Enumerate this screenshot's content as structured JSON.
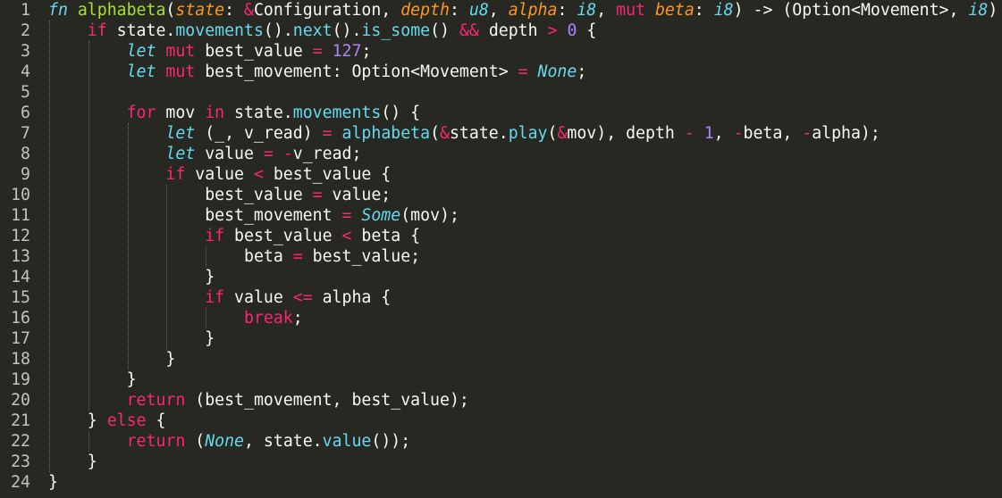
{
  "editor": {
    "language": "rust",
    "colors": {
      "background": "#272822",
      "text": "#f8f8f2",
      "keyword": "#f92672",
      "function_name": "#a6e22e",
      "parameter": "#fd971f",
      "type": "#66d9ef",
      "number": "#ae81ff",
      "line_number": "#c2c2bf"
    },
    "lines": [
      {
        "n": "1",
        "indent": 0,
        "tokens": [
          [
            "fnkw",
            "fn"
          ],
          [
            "id",
            " "
          ],
          [
            "fn",
            "alphabeta"
          ],
          [
            "id",
            "("
          ],
          [
            "param",
            "state"
          ],
          [
            "id",
            ": "
          ],
          [
            "kw",
            "&"
          ],
          [
            "id",
            "Configuration, "
          ],
          [
            "param",
            "depth"
          ],
          [
            "id",
            ": "
          ],
          [
            "type",
            "u8"
          ],
          [
            "id",
            ", "
          ],
          [
            "param",
            "alpha"
          ],
          [
            "id",
            ": "
          ],
          [
            "type",
            "i8"
          ],
          [
            "id",
            ", "
          ],
          [
            "kw",
            "mut"
          ],
          [
            "id",
            " "
          ],
          [
            "param",
            "beta"
          ],
          [
            "id",
            ": "
          ],
          [
            "type",
            "i8"
          ],
          [
            "id",
            ") -> (Option<Movement>, "
          ],
          [
            "type",
            "i8"
          ],
          [
            "id",
            ")"
          ]
        ]
      },
      {
        "n": "2",
        "indent": 1,
        "tokens": [
          [
            "kw",
            "if"
          ],
          [
            "id",
            " state."
          ],
          [
            "call",
            "movements"
          ],
          [
            "id",
            "()."
          ],
          [
            "call",
            "next"
          ],
          [
            "id",
            "()."
          ],
          [
            "call",
            "is_some"
          ],
          [
            "id",
            "() "
          ],
          [
            "kw",
            "&&"
          ],
          [
            "id",
            " depth "
          ],
          [
            "kw",
            ">"
          ],
          [
            "id",
            " "
          ],
          [
            "num",
            "0"
          ],
          [
            "id",
            " {"
          ]
        ]
      },
      {
        "n": "3",
        "indent": 2,
        "tokens": [
          [
            "fnkw",
            "let"
          ],
          [
            "id",
            " "
          ],
          [
            "kw",
            "mut"
          ],
          [
            "id",
            " best_value "
          ],
          [
            "kw",
            "="
          ],
          [
            "id",
            " "
          ],
          [
            "num",
            "127"
          ],
          [
            "id",
            ";"
          ]
        ]
      },
      {
        "n": "4",
        "indent": 2,
        "tokens": [
          [
            "fnkw",
            "let"
          ],
          [
            "id",
            " "
          ],
          [
            "kw",
            "mut"
          ],
          [
            "id",
            " best_movement: Option<Movement> "
          ],
          [
            "kw",
            "="
          ],
          [
            "id",
            " "
          ],
          [
            "type",
            "None"
          ],
          [
            "id",
            ";"
          ]
        ]
      },
      {
        "n": "5",
        "indent": 2,
        "tokens": []
      },
      {
        "n": "6",
        "indent": 2,
        "tokens": [
          [
            "kw",
            "for"
          ],
          [
            "id",
            " mov "
          ],
          [
            "kw",
            "in"
          ],
          [
            "id",
            " state."
          ],
          [
            "call",
            "movements"
          ],
          [
            "id",
            "() {"
          ]
        ]
      },
      {
        "n": "7",
        "indent": 3,
        "tokens": [
          [
            "fnkw",
            "let"
          ],
          [
            "id",
            " (_, v_read) "
          ],
          [
            "kw",
            "="
          ],
          [
            "id",
            " "
          ],
          [
            "call",
            "alphabeta"
          ],
          [
            "id",
            "("
          ],
          [
            "kw",
            "&"
          ],
          [
            "id",
            "state."
          ],
          [
            "call",
            "play"
          ],
          [
            "id",
            "("
          ],
          [
            "kw",
            "&"
          ],
          [
            "id",
            "mov), depth "
          ],
          [
            "kw",
            "-"
          ],
          [
            "id",
            " "
          ],
          [
            "num",
            "1"
          ],
          [
            "id",
            ", "
          ],
          [
            "kw",
            "-"
          ],
          [
            "id",
            "beta, "
          ],
          [
            "kw",
            "-"
          ],
          [
            "id",
            "alpha);"
          ]
        ]
      },
      {
        "n": "8",
        "indent": 3,
        "tokens": [
          [
            "fnkw",
            "let"
          ],
          [
            "id",
            " value "
          ],
          [
            "kw",
            "="
          ],
          [
            "id",
            " "
          ],
          [
            "kw",
            "-"
          ],
          [
            "id",
            "v_read;"
          ]
        ]
      },
      {
        "n": "9",
        "indent": 3,
        "tokens": [
          [
            "kw",
            "if"
          ],
          [
            "id",
            " value "
          ],
          [
            "kw",
            "<"
          ],
          [
            "id",
            " best_value {"
          ]
        ]
      },
      {
        "n": "10",
        "indent": 4,
        "tokens": [
          [
            "id",
            "best_value "
          ],
          [
            "kw",
            "="
          ],
          [
            "id",
            " value;"
          ]
        ]
      },
      {
        "n": "11",
        "indent": 4,
        "tokens": [
          [
            "id",
            "best_movement "
          ],
          [
            "kw",
            "="
          ],
          [
            "id",
            " "
          ],
          [
            "type",
            "Some"
          ],
          [
            "id",
            "(mov);"
          ]
        ]
      },
      {
        "n": "12",
        "indent": 4,
        "tokens": [
          [
            "kw",
            "if"
          ],
          [
            "id",
            " best_value "
          ],
          [
            "kw",
            "<"
          ],
          [
            "id",
            " beta {"
          ]
        ]
      },
      {
        "n": "13",
        "indent": 5,
        "tokens": [
          [
            "id",
            "beta "
          ],
          [
            "kw",
            "="
          ],
          [
            "id",
            " best_value;"
          ]
        ]
      },
      {
        "n": "14",
        "indent": 4,
        "tokens": [
          [
            "id",
            "}"
          ]
        ]
      },
      {
        "n": "15",
        "indent": 4,
        "tokens": [
          [
            "kw",
            "if"
          ],
          [
            "id",
            " value "
          ],
          [
            "kw",
            "<="
          ],
          [
            "id",
            " alpha {"
          ]
        ]
      },
      {
        "n": "16",
        "indent": 5,
        "tokens": [
          [
            "kw",
            "break"
          ],
          [
            "id",
            ";"
          ]
        ]
      },
      {
        "n": "17",
        "indent": 4,
        "tokens": [
          [
            "id",
            "}"
          ]
        ]
      },
      {
        "n": "18",
        "indent": 3,
        "tokens": [
          [
            "id",
            "}"
          ]
        ]
      },
      {
        "n": "19",
        "indent": 2,
        "tokens": [
          [
            "id",
            "}"
          ]
        ]
      },
      {
        "n": "20",
        "indent": 2,
        "tokens": [
          [
            "kw",
            "return"
          ],
          [
            "id",
            " (best_movement, best_value);"
          ]
        ]
      },
      {
        "n": "21",
        "indent": 1,
        "tokens": [
          [
            "id",
            "} "
          ],
          [
            "kw",
            "else"
          ],
          [
            "id",
            " {"
          ]
        ]
      },
      {
        "n": "22",
        "indent": 2,
        "tokens": [
          [
            "kw",
            "return"
          ],
          [
            "id",
            " ("
          ],
          [
            "type",
            "None"
          ],
          [
            "id",
            ", state."
          ],
          [
            "call",
            "value"
          ],
          [
            "id",
            "());"
          ]
        ]
      },
      {
        "n": "23",
        "indent": 1,
        "tokens": [
          [
            "id",
            "}"
          ]
        ]
      },
      {
        "n": "24",
        "indent": 0,
        "tokens": [
          [
            "id",
            "}"
          ]
        ]
      }
    ]
  }
}
